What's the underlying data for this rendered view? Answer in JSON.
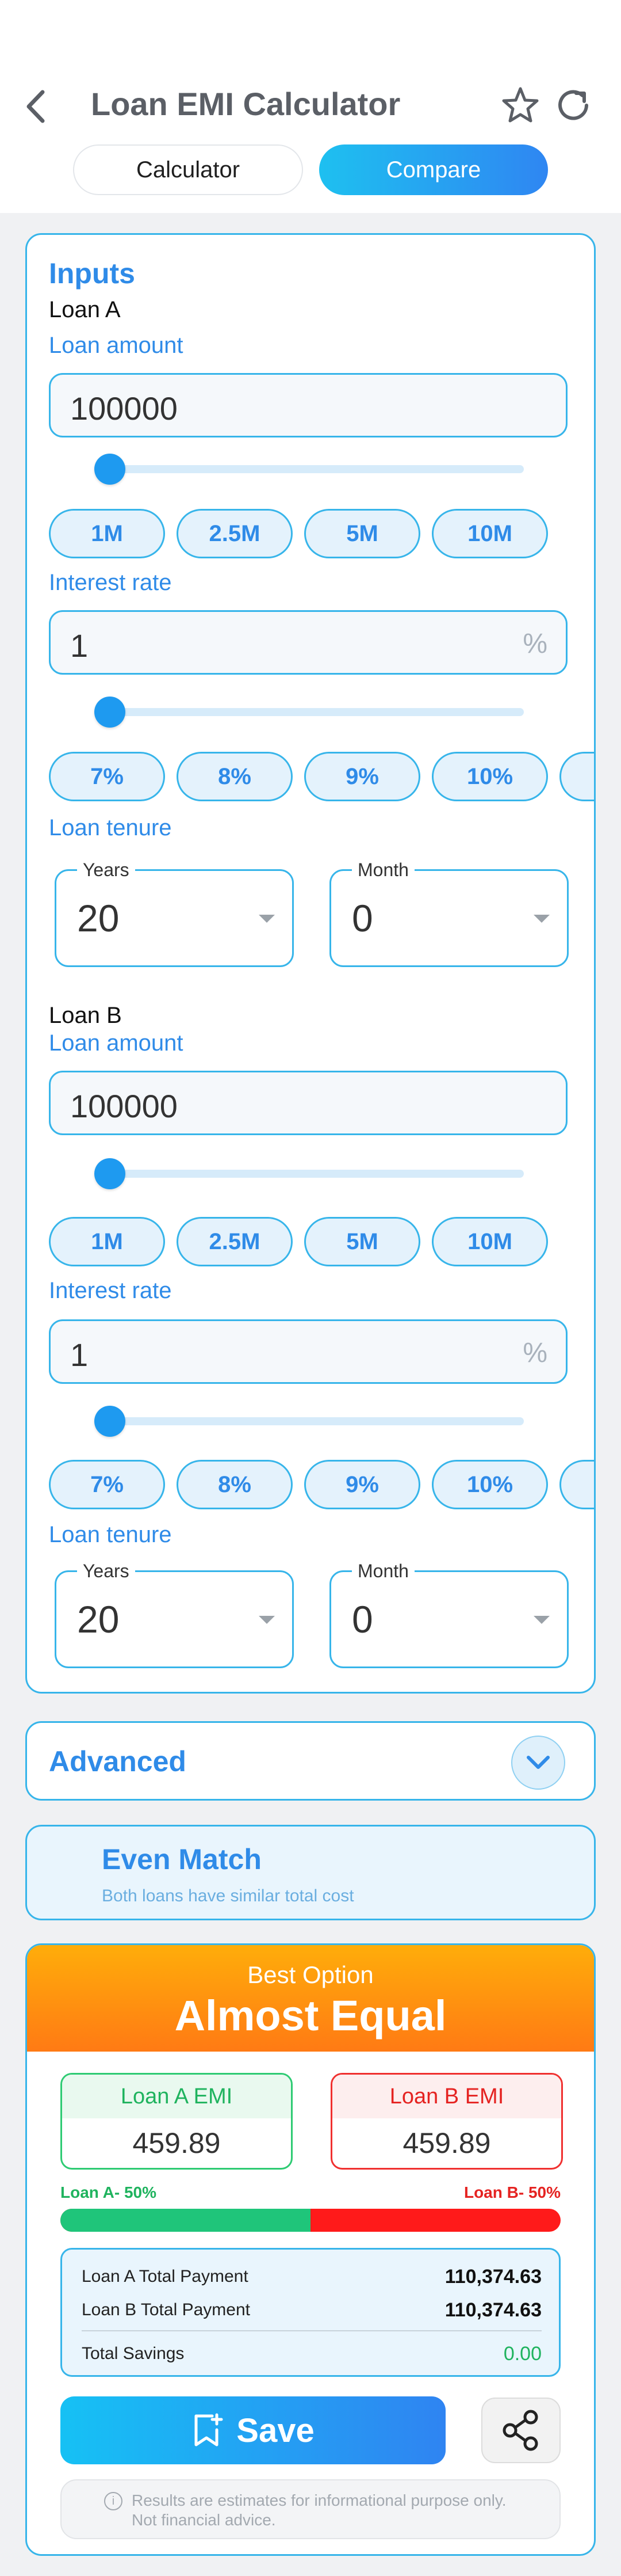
{
  "header": {
    "title": "Loan EMI Calculator",
    "tabs": [
      {
        "label": "Calculator",
        "active": false
      },
      {
        "label": "Compare",
        "active": true
      }
    ]
  },
  "inputs": {
    "section_title": "Inputs",
    "loans": [
      {
        "name": "Loan A",
        "amount_label": "Loan amount",
        "amount_value": "100000",
        "amount_slider_fraction": 0.0,
        "amount_chips": [
          "1M",
          "2.5M",
          "5M",
          "10M"
        ],
        "rate_label": "Interest rate",
        "rate_value": "1",
        "rate_unit": "%",
        "rate_slider_fraction": 0.0,
        "rate_chips": [
          "7%",
          "8%",
          "9%",
          "10%"
        ],
        "tenure_label": "Loan tenure",
        "years_label": "Years",
        "years_value": "20",
        "month_label": "Month",
        "month_value": "0"
      },
      {
        "name": "Loan B",
        "amount_label": "Loan amount",
        "amount_value": "100000",
        "amount_slider_fraction": 0.0,
        "amount_chips": [
          "1M",
          "2.5M",
          "5M",
          "10M"
        ],
        "rate_label": "Interest rate",
        "rate_value": "1",
        "rate_unit": "%",
        "rate_slider_fraction": 0.0,
        "rate_chips": [
          "7%",
          "8%",
          "9%",
          "10%"
        ],
        "tenure_label": "Loan tenure",
        "years_label": "Years",
        "years_value": "20",
        "month_label": "Month",
        "month_value": "0"
      }
    ]
  },
  "advanced": {
    "title": "Advanced"
  },
  "match": {
    "title": "Even Match",
    "subtitle": "Both loans have similar total cost"
  },
  "result": {
    "best_label": "Best Option",
    "best_value": "Almost Equal",
    "loan_a_emi_label": "Loan A EMI",
    "loan_a_emi_value": "459.89",
    "loan_b_emi_label": "Loan B EMI",
    "loan_b_emi_value": "459.89",
    "split_a_label": "Loan A- 50%",
    "split_b_label": "Loan B- 50%",
    "split_a_fraction": 0.5,
    "totals": {
      "a_label": "Loan A Total Payment",
      "a_value": "110,374.63",
      "b_label": "Loan B Total Payment",
      "b_value": "110,374.63",
      "savings_label": "Total Savings",
      "savings_value": "0.00"
    },
    "save_label": "Save",
    "disclaimer": "Results are estimates for informational purpose only. Not financial advice."
  },
  "colors": {
    "accent": "#2f8be8",
    "border": "#37b5ea",
    "loan_a": "#1fb35e",
    "loan_b": "#e52321",
    "best_gradient_start": "#ffad0a",
    "best_gradient_end": "#ff7a14"
  },
  "icons": [
    "back-chevron-icon",
    "star-icon",
    "refresh-icon",
    "chevron-down-icon",
    "bookmark-add-icon",
    "share-icon",
    "info-icon"
  ]
}
